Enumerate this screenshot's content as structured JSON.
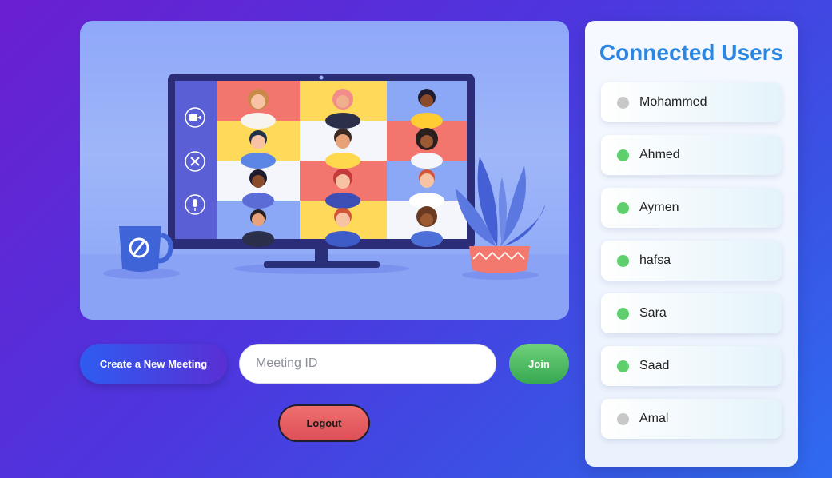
{
  "actions": {
    "create_label": "Create a New Meeting",
    "meeting_placeholder": "Meeting ID",
    "meeting_value": "",
    "join_label": "Join",
    "logout_label": "Logout"
  },
  "panel": {
    "title": "Connected Users",
    "users": [
      {
        "name": "Mohammed",
        "online": false
      },
      {
        "name": "Ahmed",
        "online": true
      },
      {
        "name": "Aymen",
        "online": true
      },
      {
        "name": "hafsa",
        "online": true
      },
      {
        "name": "Sara",
        "online": true
      },
      {
        "name": "Saad",
        "online": true
      },
      {
        "name": "Amal",
        "online": false
      }
    ]
  },
  "colors": {
    "online": "#5ecf6c",
    "offline": "#c8c8c8",
    "title": "#2a86e0",
    "accent_blue": "#2e5cf0",
    "join_green": "#37a852",
    "logout_red": "#dc4f56"
  },
  "illustration": {
    "icons": [
      "video-camera-icon",
      "close-icon",
      "microphone-icon"
    ]
  }
}
